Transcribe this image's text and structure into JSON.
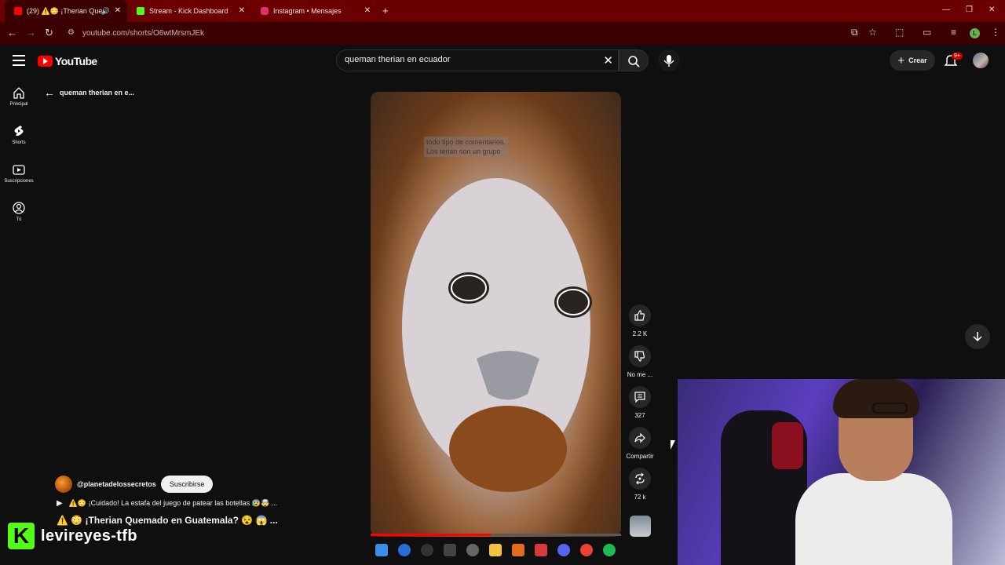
{
  "browser": {
    "tabs": [
      {
        "label": "(29) ⚠️😳 ¡Therian Quemad",
        "active": true,
        "favicon_color": "#ff0000"
      },
      {
        "label": "Stream - Kick Dashboard",
        "active": false,
        "favicon_color": "#53fc18"
      },
      {
        "label": "Instagram • Mensajes",
        "active": false,
        "favicon_color": "#e1306c"
      }
    ],
    "url": "youtube.com/shorts/O6wtMrsmJEk",
    "profile_initial": "L",
    "accent_color": "#6b0000"
  },
  "youtube": {
    "logo_text": "YouTube",
    "search": {
      "value": "queman therian en ecuador"
    },
    "create_label": "Crear",
    "notifications_badge": "9+",
    "sidebar": [
      {
        "label": "Principal",
        "icon": "home-icon"
      },
      {
        "label": "Shorts",
        "icon": "shorts-icon"
      },
      {
        "label": "Suscripciones",
        "icon": "subscriptions-icon"
      },
      {
        "label": "Tú",
        "icon": "you-icon"
      }
    ],
    "back_label": "queman therian en e...",
    "short": {
      "caption_line1": "todo tipo de comentarios.",
      "caption_line2": "Los terian son un grupo",
      "progress": 0.48,
      "actions": [
        {
          "icon": "like-icon",
          "label": "2.2 K"
        },
        {
          "icon": "dislike-icon",
          "label": "No me ..."
        },
        {
          "icon": "comment-icon",
          "label": "327"
        },
        {
          "icon": "share-icon",
          "label": "Compartir"
        },
        {
          "icon": "remix-icon",
          "label": "72 k"
        }
      ],
      "channel": "@planetadelossecretos",
      "subscribe_label": "Suscribirse",
      "related_line": "⚠️😳 ¡Cuidado! La estafa del juego de patear las botellas 😰🤯 ...",
      "title": "⚠️ 😳 ¡Therian Quemado en Guatemala? 😵 😱 ..."
    }
  },
  "overlay": {
    "kick_logo": "K",
    "streamer_name": "levireyes-tfb"
  }
}
